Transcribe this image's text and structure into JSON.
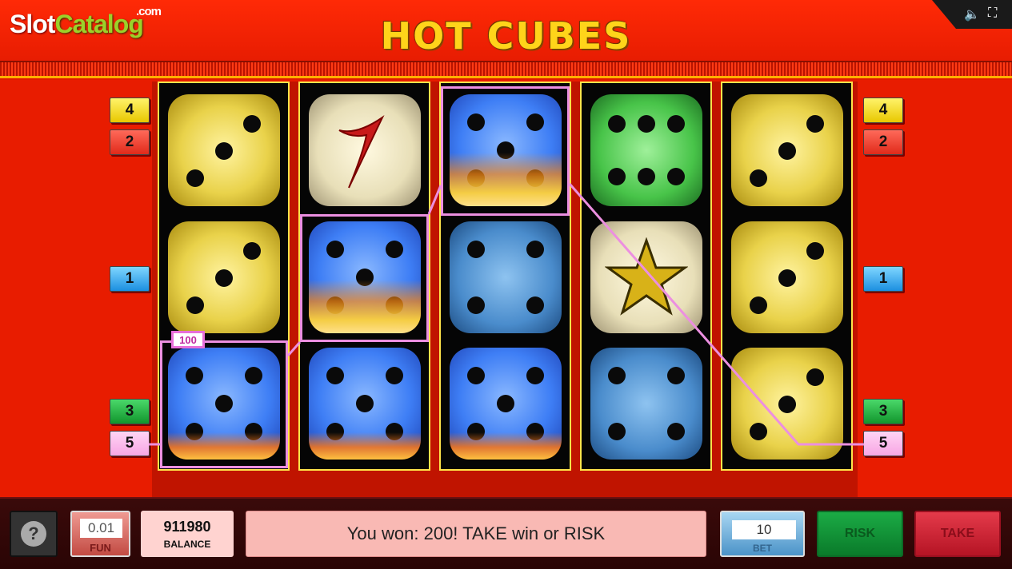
{
  "header": {
    "title": "HOT CUBES",
    "logo_slot": "Slot",
    "logo_catalog": "Catalog",
    "logo_com": ".com",
    "sound_icon": "speaker-icon",
    "fullscreen_icon": "fullscreen-icon"
  },
  "paylines": {
    "left": [
      "4",
      "2",
      "1",
      "3",
      "5"
    ],
    "right": [
      "4",
      "2",
      "1",
      "3",
      "5"
    ]
  },
  "reels": [
    [
      "yellow-3",
      "yellow-3",
      "blue-5-fire"
    ],
    [
      "seven",
      "blue-5-fire",
      "blue-5-fire"
    ],
    [
      "blue-5-fire",
      "teal-4",
      "blue-5-fire"
    ],
    [
      "green-6",
      "star",
      "teal-4"
    ],
    [
      "yellow-3",
      "yellow-3",
      "yellow-3"
    ]
  ],
  "win_tag": "100",
  "colors": {
    "background": "#e81c00",
    "highlight": "#ec8fe0",
    "title": "#ffd41a",
    "reel_border": "#ffe44a"
  },
  "bottom": {
    "help_label": "?",
    "fun_value": "0.01",
    "fun_label": "FUN",
    "balance_value": "911980",
    "balance_label": "BALANCE",
    "message": "You won: 200! TAKE win or RISK",
    "bet_value": "10",
    "bet_label": "BET",
    "risk_label": "RISK",
    "take_label": "TAKE"
  }
}
